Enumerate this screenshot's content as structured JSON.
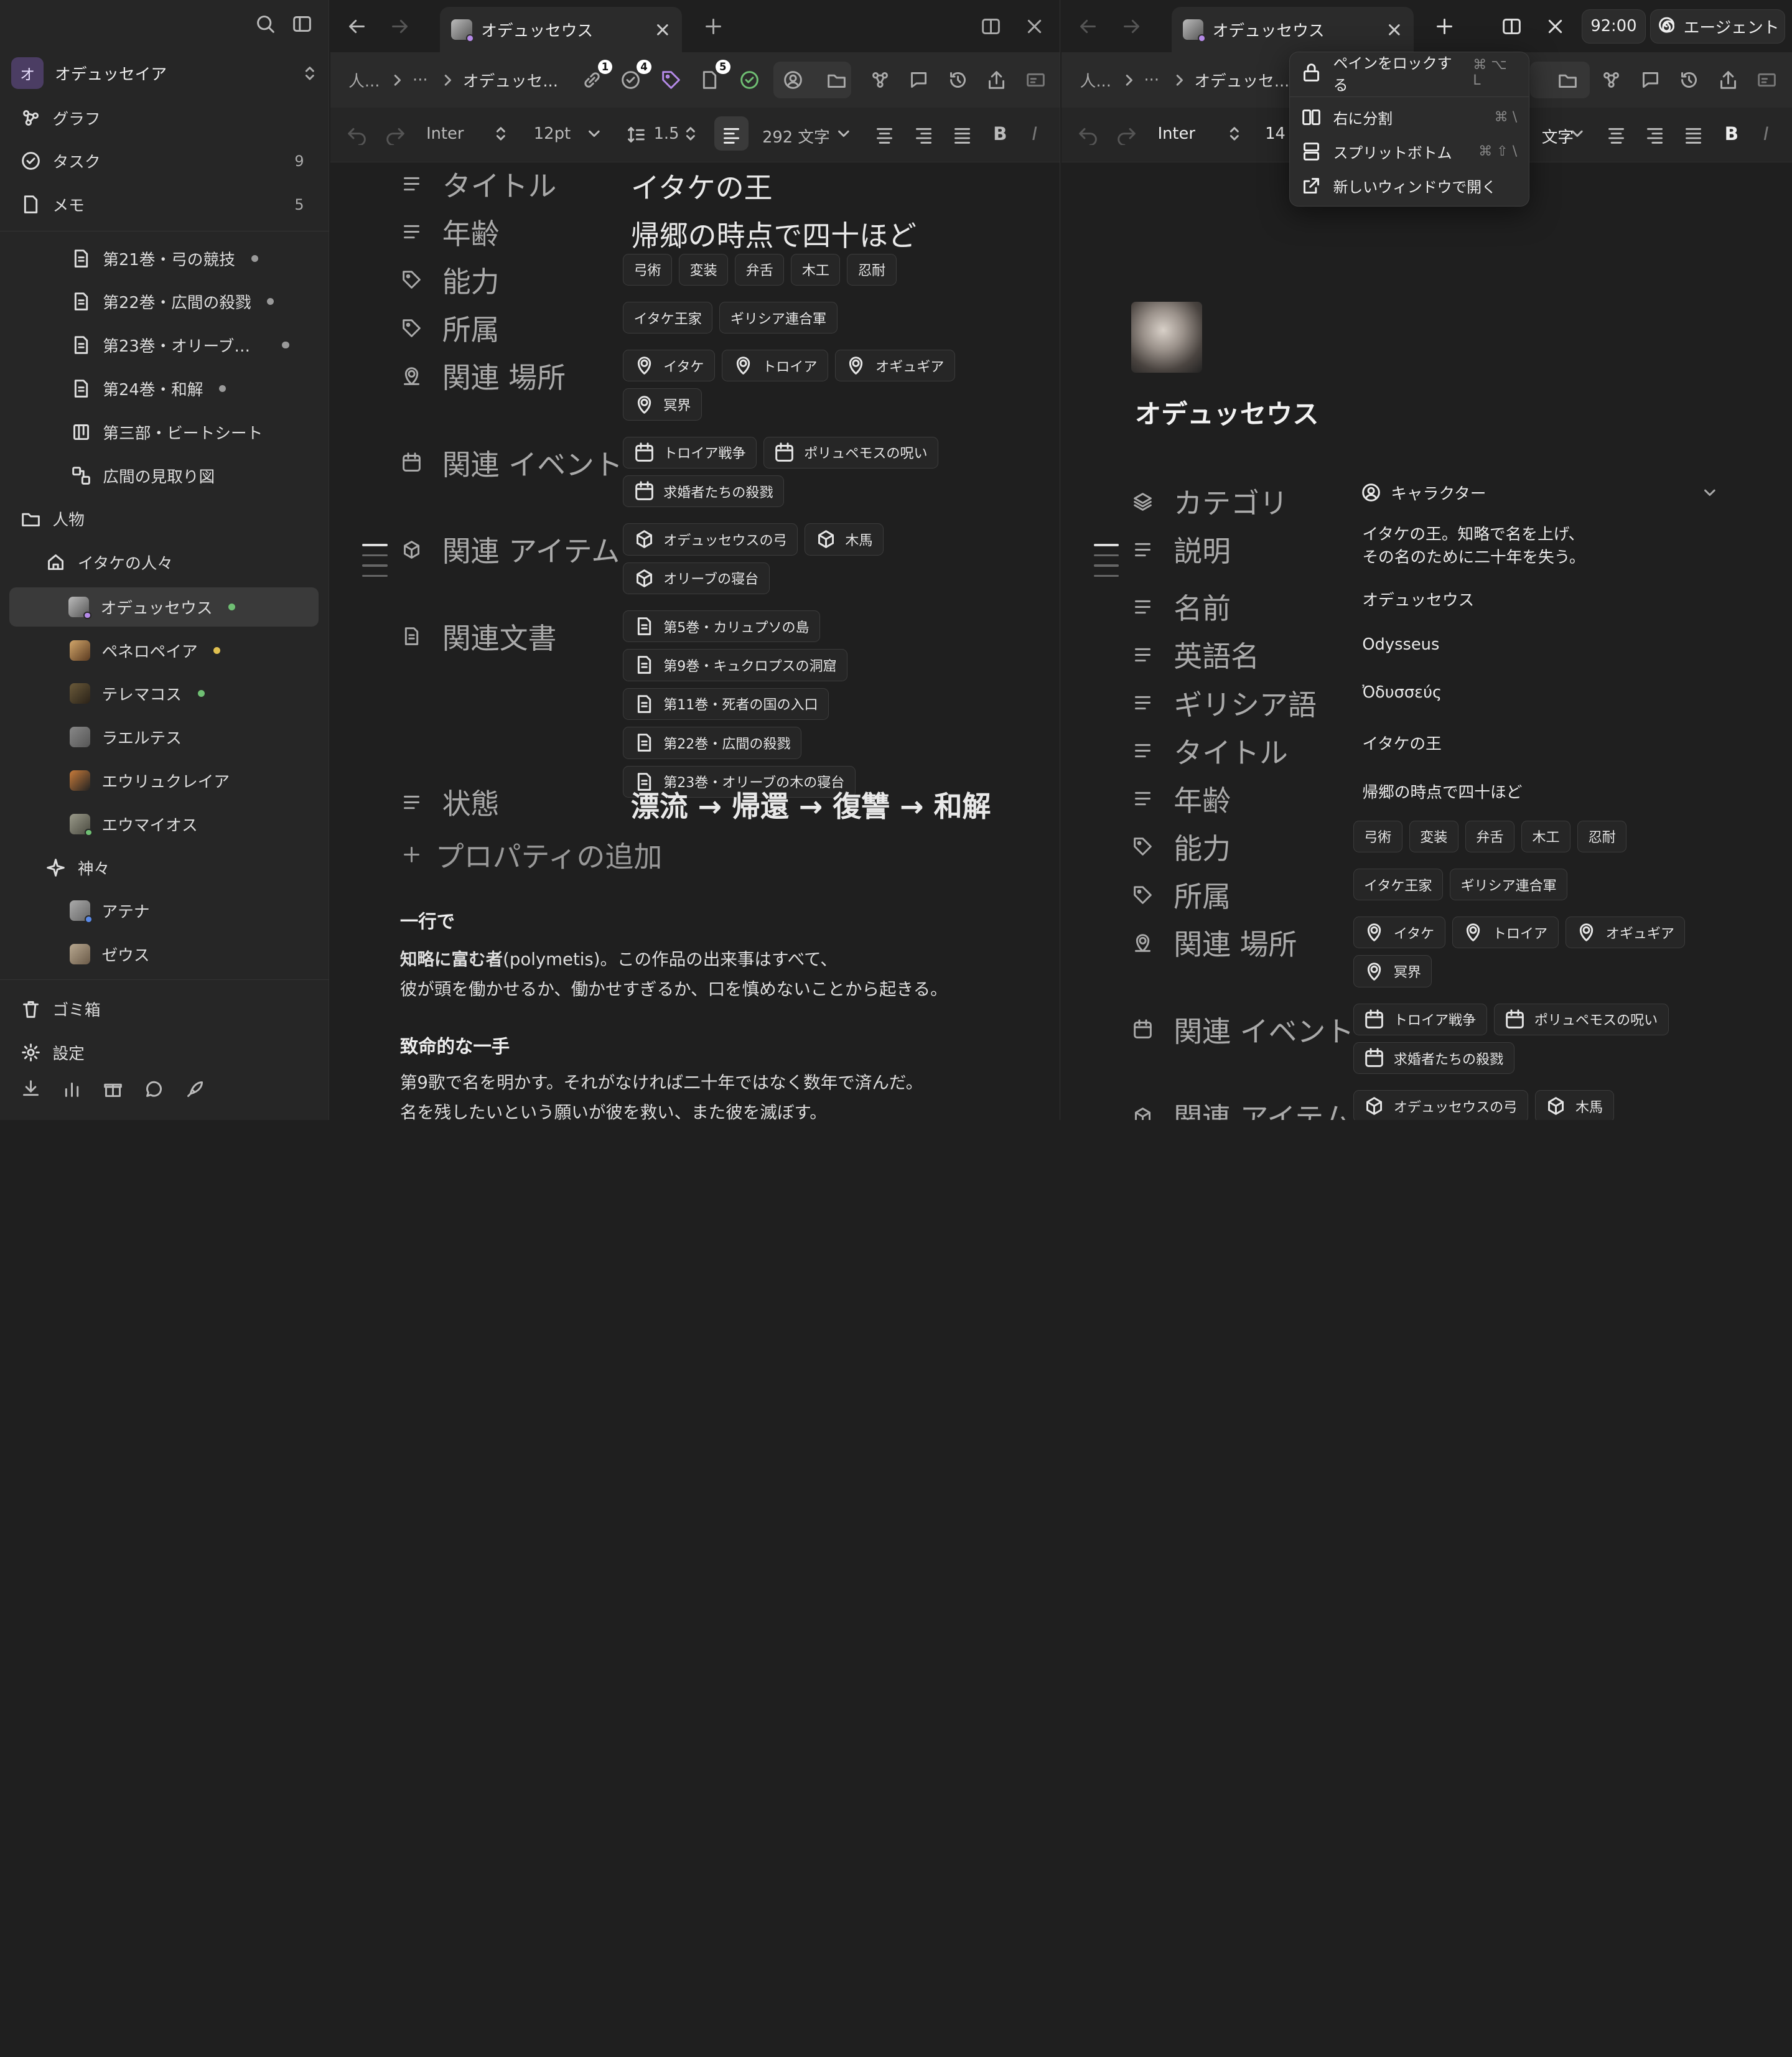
{
  "sidebar": {
    "workspace": {
      "initial": "オ",
      "name": "オデュッセイア"
    },
    "nav": [
      {
        "label": "グラフ",
        "count": ""
      },
      {
        "label": "タスク",
        "count": "9"
      },
      {
        "label": "メモ",
        "count": "5"
      }
    ],
    "docs": [
      {
        "label": "第21巻・弓の競技"
      },
      {
        "label": "第22巻・広間の殺戮"
      },
      {
        "label": "第23巻・オリーブ…"
      },
      {
        "label": "第24巻・和解"
      },
      {
        "label": "第三部・ビートシート"
      },
      {
        "label": "広間の見取り図"
      }
    ],
    "folder": "人物",
    "subfolder": "イタケの人々",
    "people": [
      {
        "label": "オデュッセウス",
        "dot": "#6fbf73"
      },
      {
        "label": "ペネロペイア",
        "dot": "#e0c050"
      },
      {
        "label": "テレマコス",
        "dot": "#6fbf73"
      },
      {
        "label": "ラエルテス",
        "dot": ""
      },
      {
        "label": "エウリュクレイア",
        "dot": ""
      },
      {
        "label": "エウマイオス",
        "dot": ""
      }
    ],
    "gods_folder": "神々",
    "gods": [
      {
        "label": "アテナ"
      },
      {
        "label": "ゼウス"
      }
    ],
    "trash": "ゴミ箱",
    "settings": "設定"
  },
  "left": {
    "tab_title": "オデュッセウス",
    "breadcrumb": [
      "人...",
      "···",
      "オデュッセ..."
    ],
    "toolbar_badges": [
      "1",
      "4",
      "5"
    ],
    "font": "Inter",
    "size": "12",
    "unit": "pt",
    "line_height": "1.5",
    "word_count": "292 文字",
    "props": [
      {
        "label": "タイトル",
        "value": "イタケの王"
      },
      {
        "label": "年齢",
        "value": "帰郷の時点で四十ほど"
      },
      {
        "label": "能力",
        "chips": [
          "弓術",
          "変装",
          "弁舌",
          "木工",
          "忍耐"
        ]
      },
      {
        "label": "所属",
        "chips": [
          "イタケ王家",
          "ギリシア連合軍"
        ]
      },
      {
        "label": "関連 場所",
        "chips": [
          "イタケ",
          "トロイア",
          "オギュギア",
          "冥界"
        ]
      },
      {
        "label": "関連 イベント",
        "chips": [
          "トロイア戦争",
          "ポリュペモスの呪い",
          "求婚者たちの殺戮"
        ]
      },
      {
        "label": "関連 アイテム",
        "chips": [
          "オデュッセウスの弓",
          "木馬",
          "オリーブの寝台"
        ]
      },
      {
        "label": "関連文書",
        "chips": [
          "第5巻・カリュプソの島",
          "第9巻・キュクロプスの洞窟",
          "第11巻・死者の国の入口",
          "第22巻・広間の殺戮",
          "第23巻・オリーブの木の寝台"
        ]
      },
      {
        "label": "状態",
        "value": "漂流 → 帰還 → 復讐 → 和解"
      }
    ],
    "add_prop": "プロパティの追加",
    "h1": "一行で",
    "p1_bold": "知略に富む者",
    "p1_rest": "(polymetis)。この作品の出来事はすべて、",
    "p1_line2": "彼が頭を働かせるか、働かせすぎるか、口を慎めないことから起きる。",
    "h2": "致命的な一手",
    "p2_line1": "第9歌で名を明かす。それがなければ二十年ではなく数年で済んだ。",
    "p2_line2": "名を残したいという願いが彼を救い、また彼を滅ぼす。"
  },
  "right": {
    "tab_title": "オデュッセウス",
    "time": "92:00",
    "agent": "エージェント",
    "breadcrumb": [
      "人...",
      "···",
      "オデュッセ..."
    ],
    "font": "Inter",
    "size": "14",
    "word_count": "文字",
    "title": "オデュッセウス",
    "category_label": "カテゴリ",
    "category_value": "キャラクター",
    "props": [
      {
        "label": "説明",
        "value": "イタケの王。知略で名を上げ、",
        "value2": "その名のために二十年を失う。"
      },
      {
        "label": "名前",
        "value": "オデュッセウス"
      },
      {
        "label": "英語名",
        "value": "Odysseus"
      },
      {
        "label": "ギリシア語",
        "value": "Ὀδυσσεύς"
      },
      {
        "label": "タイトル",
        "value": "イタケの王"
      },
      {
        "label": "年齢",
        "value": "帰郷の時点で四十ほど"
      },
      {
        "label": "能力",
        "chips": [
          "弓術",
          "変装",
          "弁舌",
          "木工",
          "忍耐"
        ]
      },
      {
        "label": "所属",
        "chips": [
          "イタケ王家",
          "ギリシア連合軍"
        ]
      },
      {
        "label": "関連 場所",
        "chips": [
          "イタケ",
          "トロイア",
          "オギュギア",
          "冥界"
        ]
      },
      {
        "label": "関連 イベント",
        "chips": [
          "トロイア戦争",
          "ポリュペモスの呪い",
          "求婚者たちの殺戮"
        ]
      },
      {
        "label": "関連 アイテム",
        "chips": [
          "オデュッセウスの弓",
          "木馬"
        ]
      }
    ]
  },
  "menu": {
    "items": [
      {
        "label": "ペインをロックする",
        "shortcut": "⌘ ⌥ L"
      },
      {
        "label": "右に分割",
        "shortcut": "⌘ \\"
      },
      {
        "label": "スプリットボトム",
        "shortcut": "⌘ ⇧ \\"
      },
      {
        "label": "新しいウィンドウで開く",
        "shortcut": ""
      }
    ]
  }
}
